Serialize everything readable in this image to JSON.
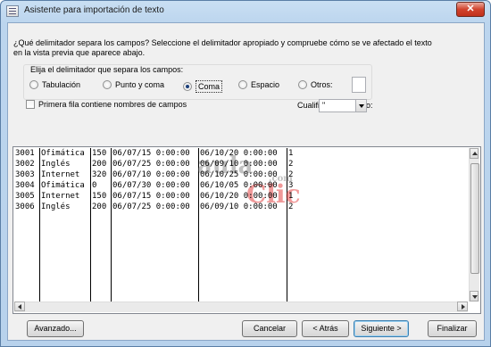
{
  "window": {
    "title": "Asistente para importación de texto",
    "close_symbol": "✕"
  },
  "question": "¿Qué delimitador separa los campos? Seleccione el delimitador apropiado y compruebe cómo se ve afectado el texto en la vista previa que aparece abajo.",
  "delimiter_group": {
    "title": "Elija el delimitador que separa los campos:",
    "options": [
      {
        "label": "Tabulación",
        "selected": false
      },
      {
        "label": "Punto y coma",
        "selected": false
      },
      {
        "label": "Coma",
        "selected": true
      },
      {
        "label": "Espacio",
        "selected": false
      },
      {
        "label": "Otros:",
        "selected": false
      }
    ],
    "otros_value": ""
  },
  "first_row_checkbox": {
    "label": "Primera fila contiene nombres de campos",
    "checked": false
  },
  "qualifier": {
    "label": "Cualificador de texto:",
    "value": "\""
  },
  "preview": {
    "rows": [
      [
        "3001",
        "Ofimática",
        "150",
        "06/07/15 0:00:00",
        "06/10/20 0:00:00",
        "1"
      ],
      [
        "3002",
        "Inglés",
        "200",
        "06/07/25 0:00:00",
        "06/09/10 0:00:00",
        "2"
      ],
      [
        "3003",
        "Internet",
        "320",
        "06/07/10 0:00:00",
        "06/10/25 0:00:00",
        "2"
      ],
      [
        "3004",
        "Ofimática",
        "0",
        "06/07/30 0:00:00",
        "06/10/05 0:00:00",
        "3"
      ],
      [
        "3005",
        "Internet",
        "150",
        "06/07/15 0:00:00",
        "06/10/20 0:00:00",
        "1"
      ],
      [
        "3006",
        "Inglés",
        "200",
        "06/07/25 0:00:00",
        "06/09/10 0:00:00",
        "2"
      ]
    ],
    "watermark": {
      "line1": "aula",
      "line2": "Clic",
      "suffix": ".com"
    }
  },
  "buttons": {
    "advanced": "Avanzado...",
    "cancel": "Cancelar",
    "back": "< Atrás",
    "next": "Siguiente >",
    "finish": "Finalizar"
  },
  "colors": {
    "accent": "#1c3f7a",
    "title_bar": "#bcd5ee",
    "close": "#c8412b",
    "watermark_red": "#e02020"
  }
}
